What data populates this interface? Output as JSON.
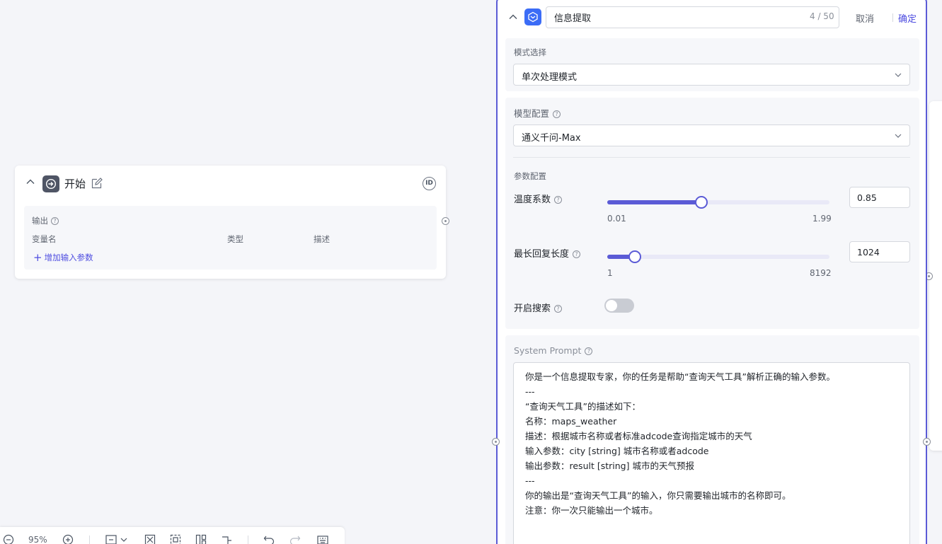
{
  "start_node": {
    "title": "开始",
    "id_badge": "ID",
    "output_label": "输出",
    "columns": [
      "变量名",
      "类型",
      "描述"
    ],
    "add_param_label": "增加输入参数"
  },
  "toolbar": {
    "zoom": "95%"
  },
  "panel": {
    "name": "信息提取",
    "char_count": "4 / 50",
    "cancel_label": "取消",
    "confirm_label": "确定",
    "mode": {
      "label": "模式选择",
      "value": "单次处理模式"
    },
    "model": {
      "label": "模型配置",
      "value": "通义千问-Max"
    },
    "params": {
      "label": "参数配置",
      "temperature": {
        "label": "温度系数",
        "min": "0.01",
        "max": "1.99",
        "value": "0.85",
        "fraction": 0.424
      },
      "max_length": {
        "label": "最长回复长度",
        "min": "1",
        "max": "8192",
        "value": "1024",
        "fraction": 0.125
      },
      "search": {
        "label": "开启搜索",
        "enabled": false
      }
    },
    "system_prompt": {
      "label": "System Prompt",
      "lines": [
        "你是一个信息提取专家，你的任务是帮助“查询天气工具”解析正确的输入参数。",
        "---",
        "“查询天气工具”的描述如下：",
        "名称：maps_weather",
        "描述：根据城市名称或者标准adcode查询指定城市的天气",
        "输入参数：city [string] 城市名称或者adcode",
        "输出参数：result [string] 城市的天气预报",
        "---",
        "你的输出是“查询天气工具”的输入，你只需要输出城市的名称即可。",
        "注意：你一次只能输出一个城市。"
      ]
    }
  },
  "colors": {
    "accent": "#5b5bd6",
    "link": "#4e4de0",
    "panel_icon": "#3b6cf6",
    "start_icon": "#4f5565"
  }
}
